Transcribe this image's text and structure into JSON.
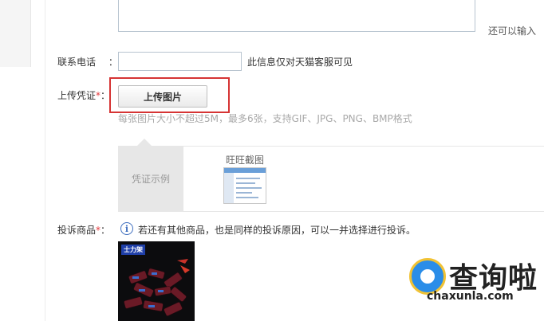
{
  "remaining_hint": "还可以输入",
  "phone": {
    "label": "联系电话",
    "colon": "：",
    "value": "",
    "note": "此信息仅对天猫客服可见"
  },
  "upload": {
    "label": "上传凭证",
    "required_mark": "*",
    "colon": "：",
    "button_label": "上传图片",
    "note": "每张图片大小不超过5M，最多6张，支持GIF、JPG、PNG、BMP格式"
  },
  "example": {
    "tab_label": "凭证示例",
    "item_title": "旺旺截图"
  },
  "product": {
    "label": "投诉商品",
    "required_mark": "*",
    "colon": "：",
    "info_icon": "info-icon",
    "info_text": "若还有其他商品，也是同样的投诉原因，可以一并选择进行投诉。",
    "image_logo": "士力架"
  },
  "watermark": {
    "name": "查询啦",
    "domain": "chaxunla.com"
  },
  "colors": {
    "highlight": "#d63434",
    "required": "#e4393c",
    "info": "#3f6fbf"
  }
}
